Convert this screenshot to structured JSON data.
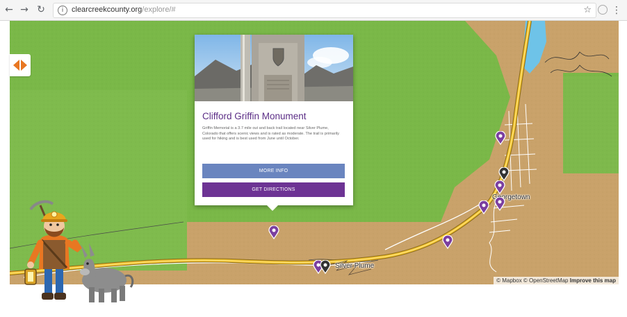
{
  "browser": {
    "back_icon": "back-arrow-icon",
    "forward_icon": "forward-arrow-icon",
    "reload_icon": "reload-icon",
    "url_host": "clearcreekcounty.org",
    "url_path": "/explore/#",
    "bookmark_icon": "star-icon",
    "menu_icon": "more-vert-icon"
  },
  "map": {
    "towns": {
      "georgetown": "Georgetown",
      "silver_plume": "Silver Plume"
    },
    "attribution": {
      "text": "© Mapbox © OpenStreetMap",
      "improve": "Improve this map"
    },
    "colors": {
      "meadow": "#7ab848",
      "desert": "#c9a26a",
      "highway": "#f2c22d",
      "water": "#6ec3e8",
      "marker": "#7b3fa0"
    }
  },
  "popup": {
    "title": "Clifford Griffin Monument",
    "description": "Griffin Memorial is a 3.7 mile out and back trail located near Silver Plume, Colorado that offers scenic views and is rated as moderate. The trail is primarily used for hiking and is best used from June until October.",
    "more_info_label": "MORE INFO",
    "directions_label": "GET DIRECTIONS"
  }
}
